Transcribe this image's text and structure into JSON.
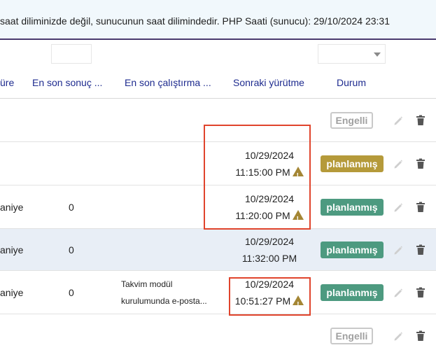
{
  "banner": {
    "text": "saat diliminizde değil, sunucunun saat dilimindedir. PHP Saati (sunucu): 29/10/2024 23:31"
  },
  "filters": {
    "text_value": "",
    "select_value": ""
  },
  "columns": {
    "duration": "üre",
    "last_result": "En son sonuç ...",
    "last_run": "En son çalıştırma ...",
    "next_run": "Sonraki yürütme",
    "status": "Durum"
  },
  "rows": [
    {
      "duration": "",
      "last_result": "",
      "description": [],
      "next_date": "",
      "next_time": "",
      "warning": false,
      "status": "Engelli",
      "status_kind": "disabled"
    },
    {
      "duration": "",
      "last_result": "",
      "description": [],
      "next_date": "10/29/2024",
      "next_time": "11:15:00 PM",
      "warning": true,
      "status": "planlanmış",
      "status_kind": "scheduled-gold"
    },
    {
      "duration": "aniye",
      "last_result": "0",
      "description": [],
      "next_date": "10/29/2024",
      "next_time": "11:20:00 PM",
      "warning": true,
      "status": "planlanmış",
      "status_kind": "scheduled"
    },
    {
      "duration": "aniye",
      "last_result": "0",
      "description": [],
      "next_date": "10/29/2024",
      "next_time": "11:32:00 PM",
      "warning": false,
      "status": "planlanmış",
      "status_kind": "scheduled"
    },
    {
      "duration": "aniye",
      "last_result": "0",
      "description": [
        "Takvim modül",
        "kurulumunda e-posta..."
      ],
      "next_date": "10/29/2024",
      "next_time": "10:51:27 PM",
      "warning": true,
      "status": "planlanmış",
      "status_kind": "scheduled"
    },
    {
      "duration": "",
      "last_result": "",
      "description": [],
      "next_date": "",
      "next_time": "",
      "warning": false,
      "status": "Engelli",
      "status_kind": "disabled"
    }
  ],
  "icons": {
    "edit": "pencil-icon",
    "delete": "trash-icon",
    "warning": "warning-icon",
    "dropdown": "chevron-down-icon"
  },
  "colors": {
    "scheduled": "#4d9a80",
    "scheduled_gold": "#b59a3a",
    "highlight": "#e0442c",
    "header_text": "#1e2b8f",
    "warning": "#a48634"
  }
}
